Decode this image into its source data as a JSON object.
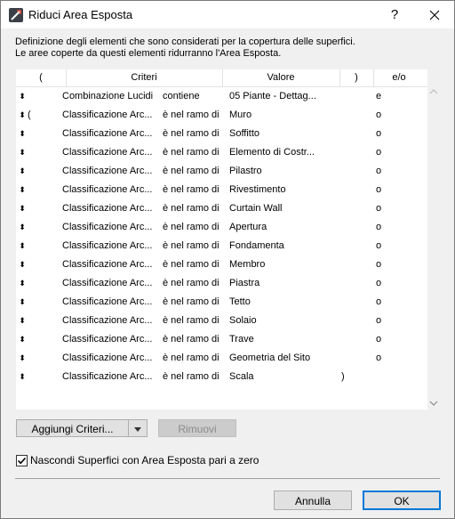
{
  "window": {
    "title": "Riduci Area Esposta",
    "help": "?"
  },
  "description": {
    "line1": "Definizione degli elementi che sono considerati per la copertura delle superfici.",
    "line2": "Le aree coperte da questi elementi ridurranno l'Area Esposta."
  },
  "table": {
    "headers": {
      "open": "(",
      "criteria": "Criteri",
      "value": "Valore",
      "close": ")",
      "andor": "e/o"
    },
    "rows": [
      {
        "open": "",
        "criterion": "Combinazione Lucidi",
        "operator": "contiene",
        "value": "05 Piante - Dettag...",
        "close": "",
        "andor": "e"
      },
      {
        "open": "(",
        "criterion": "Classificazione Arc...",
        "operator": "è nel ramo di",
        "value": "Muro",
        "close": "",
        "andor": "o"
      },
      {
        "open": "",
        "criterion": "Classificazione Arc...",
        "operator": "è nel ramo di",
        "value": "Soffitto",
        "close": "",
        "andor": "o"
      },
      {
        "open": "",
        "criterion": "Classificazione Arc...",
        "operator": "è nel ramo di",
        "value": "Elemento di Costr...",
        "close": "",
        "andor": "o"
      },
      {
        "open": "",
        "criterion": "Classificazione Arc...",
        "operator": "è nel ramo di",
        "value": "Pilastro",
        "close": "",
        "andor": "o"
      },
      {
        "open": "",
        "criterion": "Classificazione Arc...",
        "operator": "è nel ramo di",
        "value": "Rivestimento",
        "close": "",
        "andor": "o"
      },
      {
        "open": "",
        "criterion": "Classificazione Arc...",
        "operator": "è nel ramo di",
        "value": "Curtain Wall",
        "close": "",
        "andor": "o"
      },
      {
        "open": "",
        "criterion": "Classificazione Arc...",
        "operator": "è nel ramo di",
        "value": "Apertura",
        "close": "",
        "andor": "o"
      },
      {
        "open": "",
        "criterion": "Classificazione Arc...",
        "operator": "è nel ramo di",
        "value": "Fondamenta",
        "close": "",
        "andor": "o"
      },
      {
        "open": "",
        "criterion": "Classificazione Arc...",
        "operator": "è nel ramo di",
        "value": "Membro",
        "close": "",
        "andor": "o"
      },
      {
        "open": "",
        "criterion": "Classificazione Arc...",
        "operator": "è nel ramo di",
        "value": "Piastra",
        "close": "",
        "andor": "o"
      },
      {
        "open": "",
        "criterion": "Classificazione Arc...",
        "operator": "è nel ramo di",
        "value": "Tetto",
        "close": "",
        "andor": "o"
      },
      {
        "open": "",
        "criterion": "Classificazione Arc...",
        "operator": "è nel ramo di",
        "value": "Solaio",
        "close": "",
        "andor": "o"
      },
      {
        "open": "",
        "criterion": "Classificazione Arc...",
        "operator": "è nel ramo di",
        "value": "Trave",
        "close": "",
        "andor": "o"
      },
      {
        "open": "",
        "criterion": "Classificazione Arc...",
        "operator": "è nel ramo di",
        "value": "Geometria del Sito",
        "close": "",
        "andor": "o"
      },
      {
        "open": "",
        "criterion": "Classificazione Arc...",
        "operator": "è nel ramo di",
        "value": "Scala",
        "close": ")",
        "andor": ""
      }
    ]
  },
  "buttons": {
    "add": "Aggiungi Criteri...",
    "remove": "Rimuovi",
    "cancel": "Annulla",
    "ok": "OK"
  },
  "checkbox": {
    "label": "Nascondi Superfici con Area Esposta pari a zero",
    "checked": true
  },
  "colors": {
    "accent": "#0078d7",
    "icon_top": "#c0392b",
    "icon_body": "#2c3e50"
  }
}
